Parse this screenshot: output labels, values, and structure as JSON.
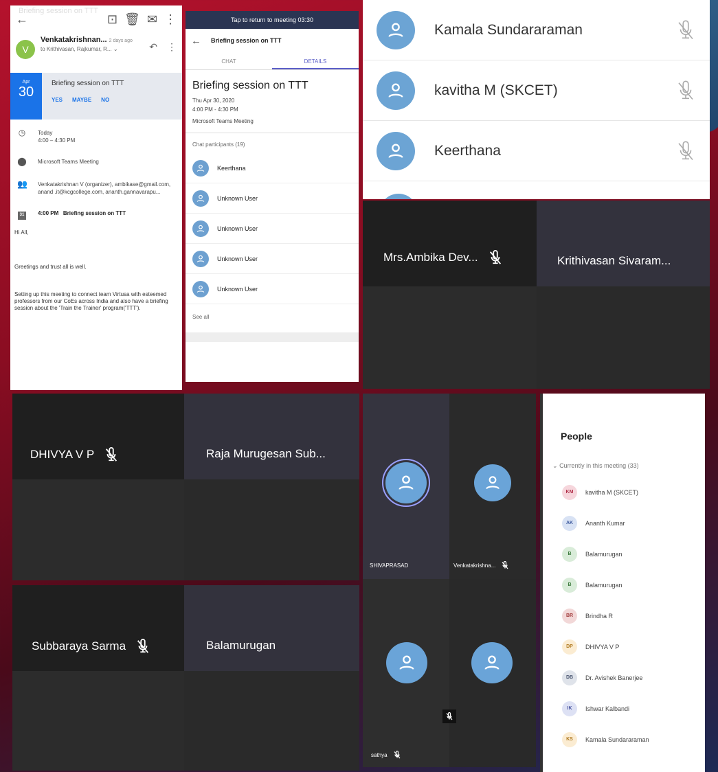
{
  "email": {
    "faint_header": "Briefing session on TTT",
    "sender_name": "Venkatakrishnan...",
    "sender_time": "2 days ago",
    "to_line": "to Krithivasan, Rajkumar, R...",
    "invite": {
      "month": "Apr",
      "day": "30",
      "title": "Briefing session on TTT",
      "yes": "YES",
      "maybe": "MAYBE",
      "no": "NO"
    },
    "when_day": "Today",
    "when_time": "4:00 – 4:30 PM",
    "location": "Microsoft Teams Meeting",
    "attendees": "Venkatakrishnan V (organizer), ambikase@gmail.com, anand .it@kcgcollege.com, ananth.gannavarapu...",
    "cal_icon_text": "31",
    "event_time": "4:00 PM",
    "event_title": "Briefing session on TTT",
    "greeting": "Hi All,",
    "body_1": "Greetings and trust all is well.",
    "body_2": "Setting up this meeting to connect team Virtusa with esteemed professors from our CoEs across India and also have a briefing session about the 'Train the Trainer' program('TTT')."
  },
  "details": {
    "banner": "Tap to return to meeting 03:30",
    "header_title": "Briefing session on TTT",
    "tab_chat": "CHAT",
    "tab_details": "DETAILS",
    "title": "Briefing session on TTT",
    "date": "Thu Apr 30, 2020",
    "time": "4:00 PM - 4:30 PM",
    "location": "Microsoft Teams Meeting",
    "participants_label": "Chat participants (19)",
    "participants": [
      "Keerthana",
      "Unknown User",
      "Unknown User",
      "Unknown User",
      "Unknown User"
    ],
    "see_all": "See all"
  },
  "participant_list": [
    "Kamala Sundararaman",
    "kavitha M (SKCET)",
    "Keerthana"
  ],
  "grid1": {
    "left_name": "Mrs.Ambika Dev...",
    "right_name": "Krithivasan Sivaram..."
  },
  "grid2": {
    "left_name": "DHIVYA V P",
    "right_name": "Raja Murugesan Sub..."
  },
  "grid3": {
    "left_name": "Subbaraya Sarma",
    "right_name": "Balamurugan"
  },
  "avatar_tiles": {
    "tl_name": "SHIVAPRASAD",
    "tr_name": "Venkatakrishna...",
    "bl_name": "sathya"
  },
  "people": {
    "title": "People",
    "current_label": "Currently in this meeting (33)",
    "members": [
      {
        "initials": "KM",
        "name": "kavitha M (SKCET)",
        "bg": "#f6d6dc",
        "fg": "#b0304a"
      },
      {
        "initials": "AK",
        "name": "Ananth Kumar",
        "bg": "#d8e2f4",
        "fg": "#3d5a9e"
      },
      {
        "initials": "B",
        "name": "Balamurugan",
        "bg": "#d9ecd9",
        "fg": "#3c7a3c"
      },
      {
        "initials": "B",
        "name": "Balamurugan",
        "bg": "#d9ecd9",
        "fg": "#3c7a3c"
      },
      {
        "initials": "BR",
        "name": "Brindha R",
        "bg": "#f2d8d8",
        "fg": "#a03a3a"
      },
      {
        "initials": "DP",
        "name": "DHIVYA V P",
        "bg": "#fbecd2",
        "fg": "#b07a20"
      },
      {
        "initials": "DB",
        "name": "Dr. Avishek Banerjee",
        "bg": "#dfe3ea",
        "fg": "#4a5670"
      },
      {
        "initials": "IK",
        "name": "Ishwar Kalbandi",
        "bg": "#dde1f4",
        "fg": "#4a55a0"
      },
      {
        "initials": "KS",
        "name": "Kamala Sundararaman",
        "bg": "#fbecd2",
        "fg": "#b07a20"
      }
    ]
  },
  "colors": {
    "teams_purple": "#5b5fc7",
    "gmail_blue": "#1a73e8",
    "avatar_blue": "#6ca4d4",
    "tile_dark": "#242424",
    "tile_mid": "#2f2f38"
  }
}
